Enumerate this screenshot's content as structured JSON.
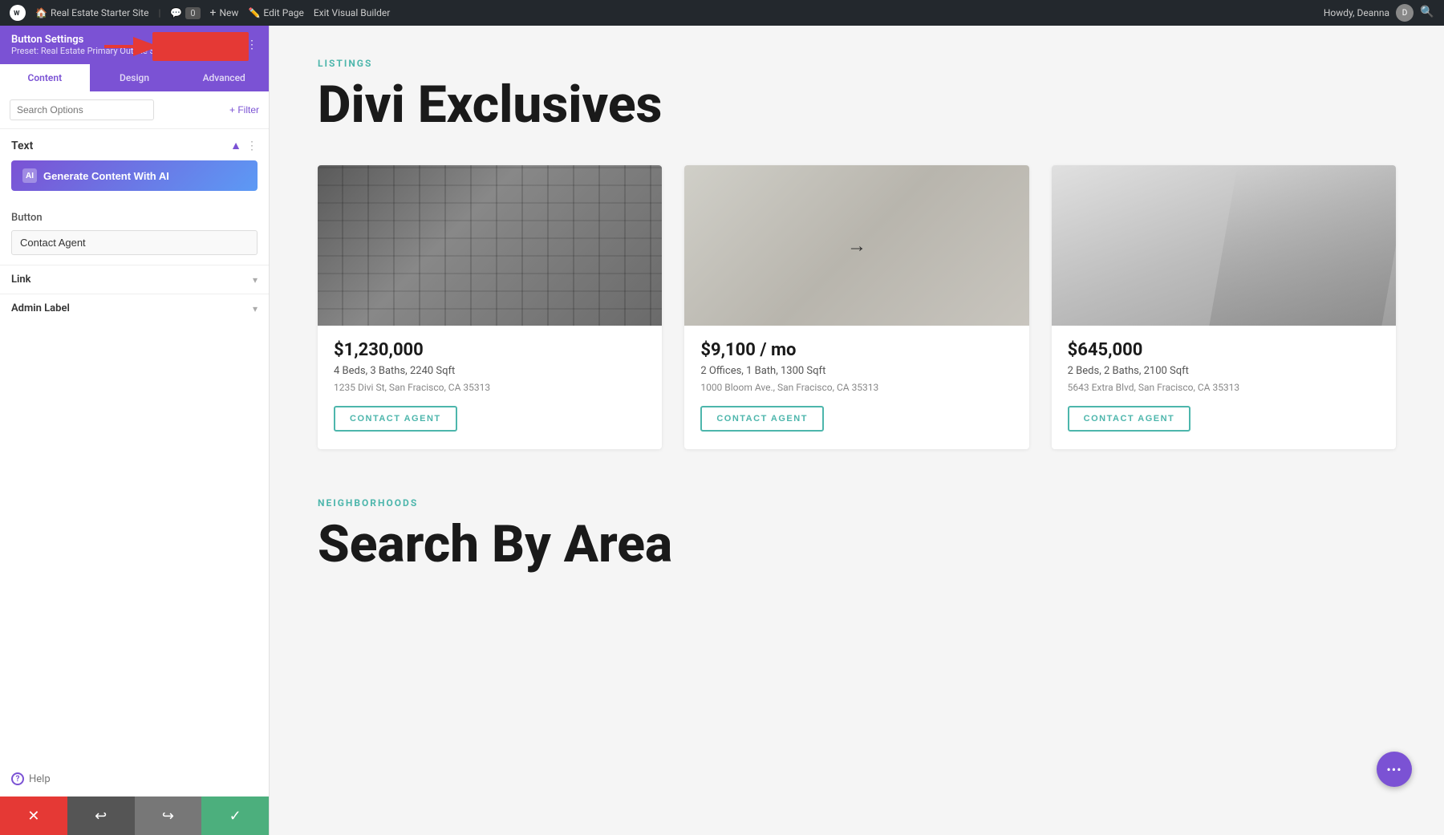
{
  "topbar": {
    "wp_icon": "W",
    "site_name": "Real Estate Starter Site",
    "comment_count": "0",
    "new_label": "New",
    "edit_page_label": "Edit Page",
    "exit_builder_label": "Exit Visual Builder",
    "howdy_label": "Howdy, Deanna",
    "avatar_initials": "D"
  },
  "sidebar": {
    "title": "Button Settings",
    "preset_label": "Preset: Real Estate Primary Outline Small",
    "icons": [
      "copy-icon",
      "layout-icon",
      "more-icon"
    ],
    "tabs": [
      {
        "label": "Content",
        "active": true
      },
      {
        "label": "Design",
        "active": false
      },
      {
        "label": "Advanced",
        "active": false
      }
    ],
    "search_placeholder": "Search Options",
    "filter_label": "+ Filter",
    "text_section": {
      "title": "Text",
      "ai_button_label": "Generate Content With AI",
      "ai_icon_label": "AI"
    },
    "button_section": {
      "label": "Button",
      "input_value": "Contact Agent"
    },
    "link_section": {
      "title": "Link"
    },
    "admin_label_section": {
      "title": "Admin Label"
    },
    "help_label": "Help",
    "bottom_bar": {
      "close_icon": "✕",
      "undo_icon": "↩",
      "redo_icon": "↪",
      "save_icon": "✓"
    }
  },
  "main": {
    "listings": {
      "section_label": "LISTINGS",
      "heading": "Divi Exclusives",
      "cards": [
        {
          "price": "$1,230,000",
          "details": "4 Beds, 3 Baths, 2240 Sqft",
          "address": "1235 Divi St, San Fracisco, CA 35313",
          "button_label": "CONTACT AGENT",
          "image_type": "building1"
        },
        {
          "price": "$9,100 / mo",
          "details": "2 Offices, 1 Bath, 1300 Sqft",
          "address": "1000 Bloom Ave., San Fracisco, CA 35313",
          "button_label": "CONTACT AGENT",
          "image_type": "building2"
        },
        {
          "price": "$645,000",
          "details": "2 Beds, 2 Baths, 2100 Sqft",
          "address": "5643 Extra Blvd, San Fracisco, CA 35313",
          "button_label": "CONTACT AGENT",
          "image_type": "building3"
        }
      ]
    },
    "neighborhoods": {
      "section_label": "NEIGHBORHOODS",
      "heading": "Search By Area"
    }
  }
}
